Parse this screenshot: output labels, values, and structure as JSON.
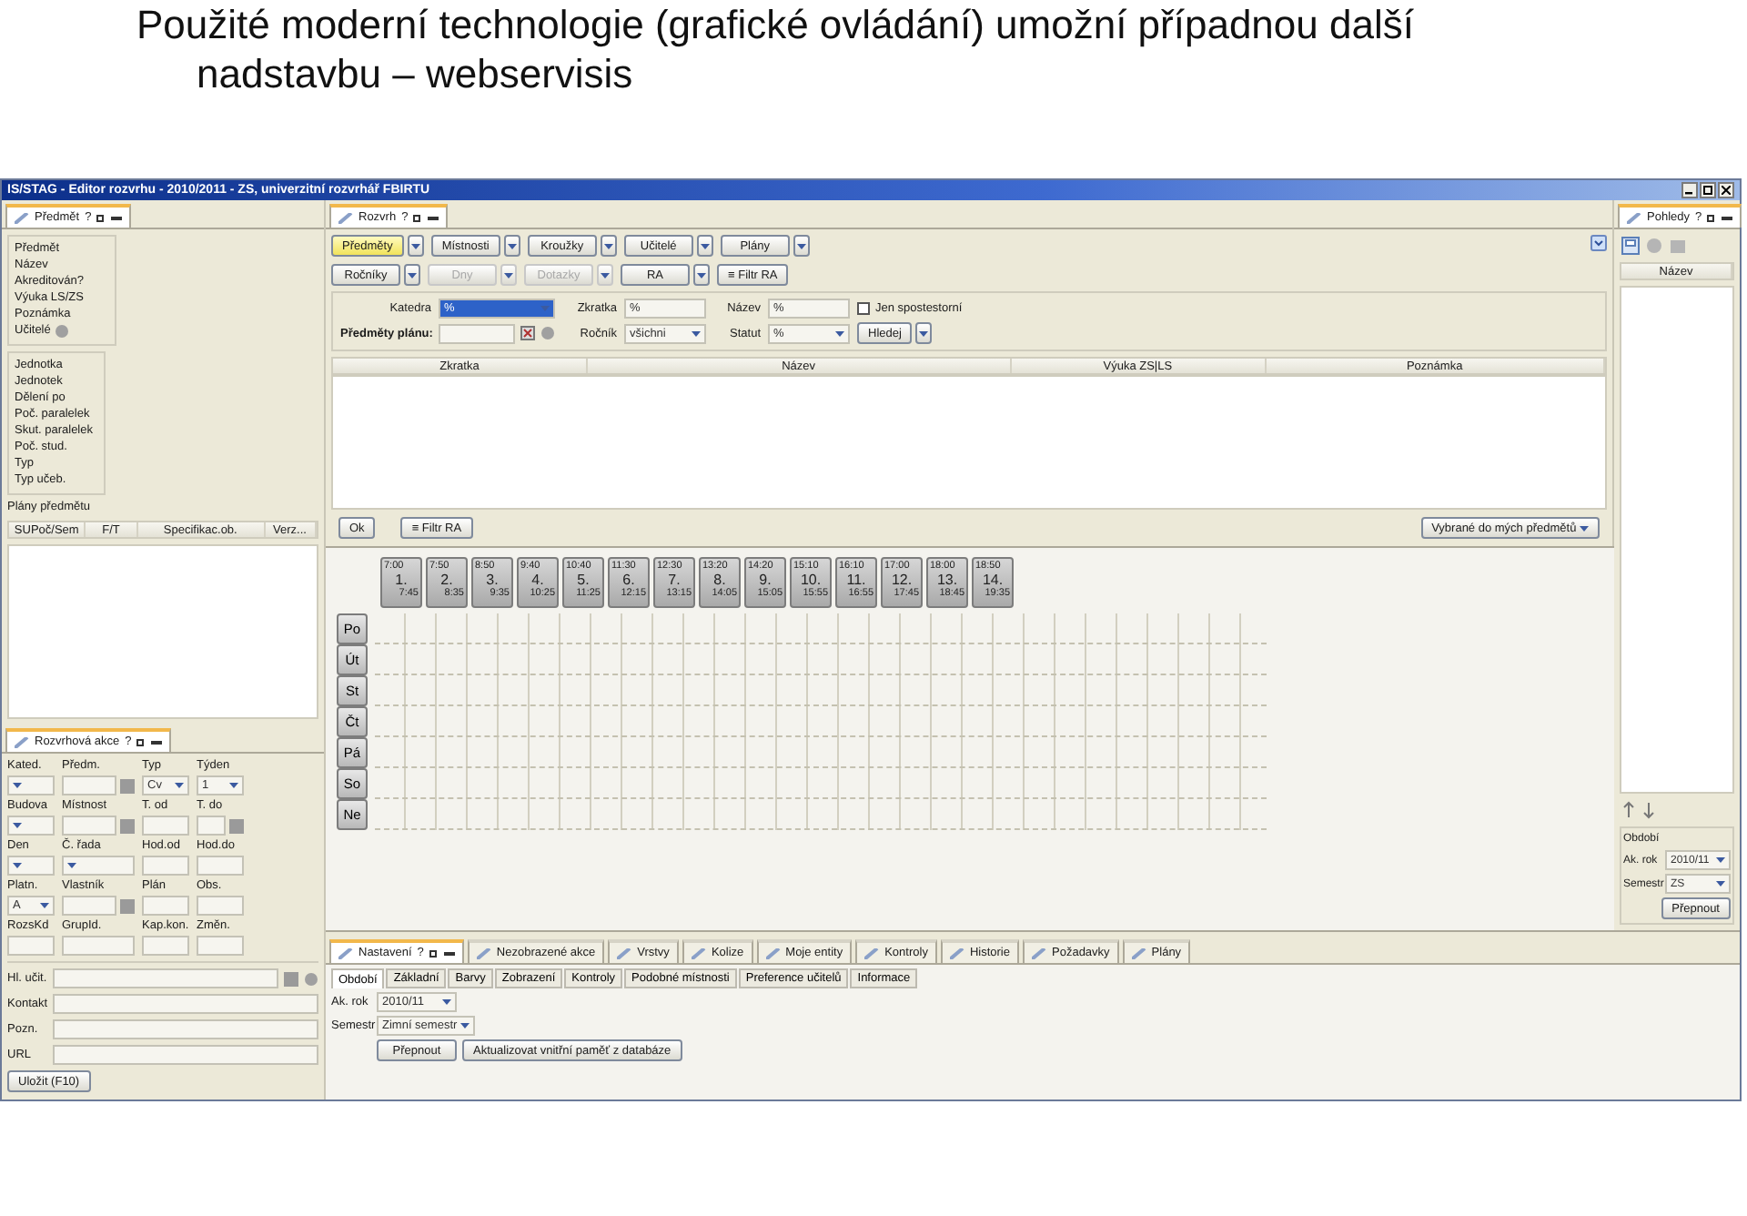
{
  "heading": {
    "text": "Použité moderní technologie (grafické ovládání) umožní případnou další nadstavbu – webservisis"
  },
  "window": {
    "title": "IS/STAG - Editor rozvrhu - 2010/2011 - ZS, univerzitní rozvrhář FBIRTU"
  },
  "subject_panel": {
    "tab": {
      "label": "Předmět",
      "help": "?"
    },
    "group_1": [
      "Předmět",
      "Název",
      "Akreditován?",
      "Výuka LS/ZS",
      "Poznámka",
      "Učitelé"
    ],
    "group_2": [
      "Jednotka",
      "Jednotek",
      "Dělení po",
      "Poč. paralelek",
      "Skut. paralelek",
      "Poč. stud.",
      "Typ",
      "Typ učeb."
    ],
    "plans_label": "Plány předmětu",
    "columns": [
      "SUPoč/Sem",
      "F/T",
      "Specifikac.ob.",
      "Verz..."
    ]
  },
  "action_panel": {
    "tab": {
      "label": "Rozvrhová akce",
      "help": "?"
    },
    "rows": [
      [
        {
          "label": "Kated.",
          "kind": "select"
        },
        {
          "label": "Předm.",
          "kind": "lookup"
        },
        {
          "label": "Typ",
          "kind": "select",
          "value": "Cv"
        },
        {
          "label": "Týden",
          "kind": "select",
          "value": "1"
        }
      ],
      [
        {
          "label": "Budova",
          "kind": "select"
        },
        {
          "label": "Místnost",
          "kind": "lookup"
        },
        {
          "label": "T. od",
          "kind": "text"
        },
        {
          "label": "T. do",
          "kind": "lookup"
        }
      ],
      [
        {
          "label": "Den",
          "kind": "select"
        },
        {
          "label": "Č. řada",
          "kind": "select"
        },
        {
          "label": "Hod.od",
          "kind": "text"
        },
        {
          "label": "Hod.do",
          "kind": "text"
        }
      ],
      [
        {
          "label": "Platn.",
          "kind": "select",
          "value": "A"
        },
        {
          "label": "Vlastník",
          "kind": "lookup"
        },
        {
          "label": "Plán",
          "kind": "text"
        },
        {
          "label": "Obs.",
          "kind": "text"
        }
      ],
      [
        {
          "label": "RozsKd",
          "kind": "text"
        },
        {
          "label": "GrupId.",
          "kind": "text"
        },
        {
          "label": "Kap.kon.",
          "kind": "text"
        },
        {
          "label": "Změn.",
          "kind": "text"
        }
      ]
    ],
    "text_fields": [
      {
        "label": "Hl. učit.",
        "kind": "lookup"
      },
      {
        "label": "Kontakt",
        "kind": "text"
      },
      {
        "label": "Pozn.",
        "kind": "text"
      },
      {
        "label": "URL",
        "kind": "text"
      }
    ],
    "save_button": "Uložit (F10)"
  },
  "schedule_panel": {
    "tab": {
      "label": "Rozvrh",
      "help": "?"
    },
    "toolbar_rows": [
      [
        {
          "label": "Předměty",
          "selected": true,
          "disabled": false
        },
        {
          "label": "Místnosti",
          "selected": false,
          "disabled": false
        },
        {
          "label": "Kroužky",
          "selected": false,
          "disabled": false
        },
        {
          "label": "Učitelé",
          "selected": false,
          "disabled": false
        },
        {
          "label": "Plány",
          "selected": false,
          "disabled": false
        }
      ],
      [
        {
          "label": "Ročníky",
          "selected": false,
          "disabled": false
        },
        {
          "label": "Dny",
          "selected": false,
          "disabled": true
        },
        {
          "label": "Dotazky",
          "selected": false,
          "disabled": true
        },
        {
          "label": "RA",
          "selected": false,
          "disabled": false
        }
      ]
    ],
    "filter_ra_button": "≡ Filtr RA",
    "filter": {
      "katedra": {
        "label": "Katedra",
        "value": "%"
      },
      "zkratka": {
        "label": "Zkratka",
        "value": "%"
      },
      "nazev": {
        "label": "Název",
        "value": "%"
      },
      "only": {
        "label": "Jen spostestorní",
        "checked": false
      },
      "plan": {
        "label": "Předměty plánu:"
      },
      "rocnik": {
        "label": "Ročník",
        "value": "všichni"
      },
      "statut": {
        "label": "Statut",
        "value": "%"
      },
      "search_button": "Hledej"
    },
    "columns": [
      "Zkratka",
      "Název",
      "Výuka ZS|LS",
      "Poznámka"
    ],
    "ok_button": "Ok",
    "filter_button": "≡ Filtr RA",
    "selected_button": "Vybrané do mých předmětů"
  },
  "timetable": {
    "slots": [
      {
        "start": "7:00",
        "number": "1.",
        "end": "7:45"
      },
      {
        "start": "7:50",
        "number": "2.",
        "end": "8:35"
      },
      {
        "start": "8:50",
        "number": "3.",
        "end": "9:35"
      },
      {
        "start": "9:40",
        "number": "4.",
        "end": "10:25"
      },
      {
        "start": "10:40",
        "number": "5.",
        "end": "11:25"
      },
      {
        "start": "11:30",
        "number": "6.",
        "end": "12:15"
      },
      {
        "start": "12:30",
        "number": "7.",
        "end": "13:15"
      },
      {
        "start": "13:20",
        "number": "8.",
        "end": "14:05"
      },
      {
        "start": "14:20",
        "number": "9.",
        "end": "15:05"
      },
      {
        "start": "15:10",
        "number": "10.",
        "end": "15:55"
      },
      {
        "start": "16:10",
        "number": "11.",
        "end": "16:55"
      },
      {
        "start": "17:00",
        "number": "12.",
        "end": "17:45"
      },
      {
        "start": "18:00",
        "number": "13.",
        "end": "18:45"
      },
      {
        "start": "18:50",
        "number": "14.",
        "end": "19:35"
      }
    ],
    "days": [
      "Po",
      "Út",
      "St",
      "Čt",
      "Pá",
      "So",
      "Ne"
    ]
  },
  "views_panel": {
    "tab": {
      "label": "Pohledy",
      "help": "?"
    },
    "column": "Název",
    "period": {
      "title": "Období",
      "year": {
        "label": "Ak. rok",
        "value": "2010/11"
      },
      "semester": {
        "label": "Semestr",
        "value": "ZS"
      },
      "button": "Přepnout"
    }
  },
  "bottom_panel": {
    "tabs": [
      {
        "label": "Nastavení",
        "selected": true
      },
      {
        "label": "Nezobrazené akce",
        "selected": false
      },
      {
        "label": "Vrstvy",
        "selected": false
      },
      {
        "label": "Kolize",
        "selected": false
      },
      {
        "label": "Moje entity",
        "selected": false
      },
      {
        "label": "Kontroly",
        "selected": false
      },
      {
        "label": "Historie",
        "selected": false
      },
      {
        "label": "Požadavky",
        "selected": false
      },
      {
        "label": "Plány",
        "selected": false
      }
    ],
    "help": "?",
    "subtabs": [
      {
        "label": "Období",
        "selected": true
      },
      {
        "label": "Základní",
        "selected": false
      },
      {
        "label": "Barvy",
        "selected": false
      },
      {
        "label": "Zobrazení",
        "selected": false
      },
      {
        "label": "Kontroly",
        "selected": false
      },
      {
        "label": "Podobné místnosti",
        "selected": false
      },
      {
        "label": "Preference učitelů",
        "selected": false
      },
      {
        "label": "Informace",
        "selected": false
      }
    ],
    "year": {
      "label": "Ak. rok",
      "value": "2010/11"
    },
    "semester": {
      "label": "Semestr",
      "value": "Zimní semestr"
    },
    "switch_button": "Přepnout",
    "refresh_button": "Aktualizovat vnitřní paměť z databáze"
  }
}
